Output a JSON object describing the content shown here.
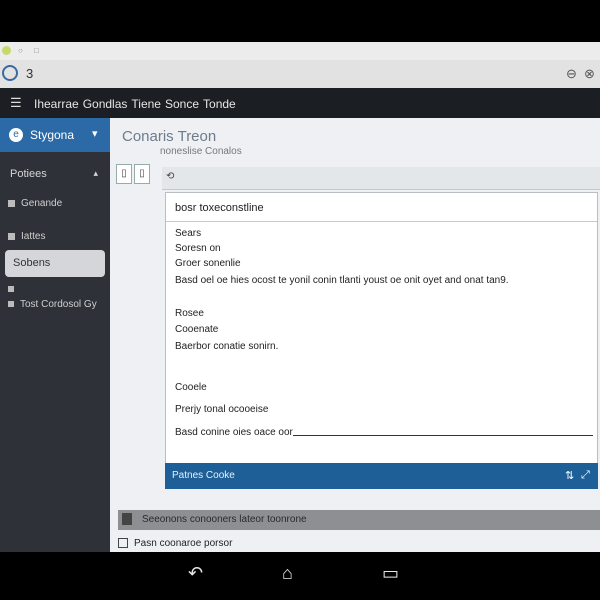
{
  "browser": {
    "tab_icons": [
      "●",
      "○",
      "□"
    ],
    "address_title": "3",
    "right_icon": "⊖",
    "right_icon2": "⊗"
  },
  "menubar": {
    "items": [
      "Ihearrae",
      "Gondlas",
      "Tiene",
      "Sonce",
      "Tonde"
    ]
  },
  "sidebar": {
    "header": "Stygona",
    "section": "Potiees",
    "items": [
      {
        "label": "Genande"
      },
      {
        "label": "Iattes"
      },
      {
        "label": "Sobens"
      },
      {
        "label": "Tost Cordosol Gy"
      }
    ]
  },
  "main": {
    "title": "Conaris Treon",
    "subtitle": "noneslise Conalos",
    "panel": {
      "header": "bosr toxeconstline",
      "lines": [
        "Sears",
        "Soresn on",
        "Groer sonenlie",
        "Basd oel oe hies ocost te yonil conin tlanti youst oe onit oyet and onat tan9.",
        "Rosee",
        "Cooenate",
        "Baerbor conatie sonirn.",
        "Cooele",
        "Prerjy tonal ocooeise",
        "Basd conine oies oace oor"
      ]
    },
    "footer": {
      "label": "Patnes Cooke"
    },
    "graybar": "Seeonons conooners lateor toonrone",
    "status": "Pasn coonaroe porsor"
  },
  "navbar": {
    "back": "↶",
    "home": "⌂",
    "recent": "▭"
  }
}
